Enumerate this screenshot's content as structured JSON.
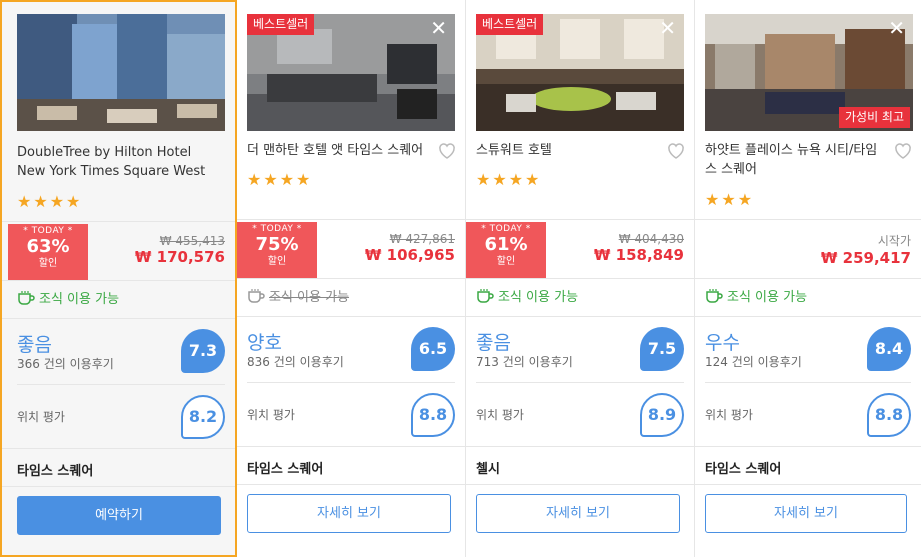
{
  "colors": {
    "accent": "#4a90e2",
    "deal": "#f0575a",
    "badge": "#e8323c",
    "breakfast": "#3aa843",
    "selected": "#f5a623"
  },
  "hotels": [
    {
      "name": "DoubleTree by Hilton Hotel New York Times Square West",
      "badge": "",
      "value_badge": "",
      "stars": 4,
      "today_label": "* TODAY *",
      "discount": "63%",
      "discount_label": "할인",
      "old_price": "₩ 455,413",
      "price": "₩ 170,576",
      "price_prefix": "",
      "breakfast": "조식 이용 가능",
      "breakfast_available": true,
      "score_word": "좋음",
      "reviews": "366 건의 이용후기",
      "score": "7.3",
      "location_label": "위치 평가",
      "location_score": "8.2",
      "area": "타임스 스퀘어",
      "button": "예약하기"
    },
    {
      "name": "더 맨하탄 호텔 앳 타임스 스퀘어",
      "badge": "베스트셀러",
      "value_badge": "",
      "stars": 4,
      "today_label": "* TODAY *",
      "discount": "75%",
      "discount_label": "할인",
      "old_price": "₩ 427,861",
      "price": "₩ 106,965",
      "price_prefix": "",
      "breakfast": "조식 이용 가능",
      "breakfast_available": false,
      "score_word": "양호",
      "reviews": "836 건의 이용후기",
      "score": "6.5",
      "location_label": "위치 평가",
      "location_score": "8.8",
      "area": "타임스 스퀘어",
      "button": "자세히 보기"
    },
    {
      "name": "스튜워트 호텔",
      "badge": "베스트셀러",
      "value_badge": "",
      "stars": 4,
      "today_label": "* TODAY *",
      "discount": "61%",
      "discount_label": "할인",
      "old_price": "₩ 404,430",
      "price": "₩ 158,849",
      "price_prefix": "",
      "breakfast": "조식 이용 가능",
      "breakfast_available": true,
      "score_word": "좋음",
      "reviews": "713 건의 이용후기",
      "score": "7.5",
      "location_label": "위치 평가",
      "location_score": "8.9",
      "area": "첼시",
      "button": "자세히 보기"
    },
    {
      "name": "하얏트 플레이스 뉴욕 시티/타임스 스퀘어",
      "badge": "",
      "value_badge": "가성비 최고",
      "stars": 3,
      "today_label": "",
      "discount": "",
      "discount_label": "",
      "old_price": "",
      "price": "₩ 259,417",
      "price_prefix": "시작가",
      "breakfast": "조식 이용 가능",
      "breakfast_available": true,
      "score_word": "우수",
      "reviews": "124 건의 이용후기",
      "score": "8.4",
      "location_label": "위치 평가",
      "location_score": "8.8",
      "area": "타임스 스퀘어",
      "button": "자세히 보기"
    }
  ]
}
